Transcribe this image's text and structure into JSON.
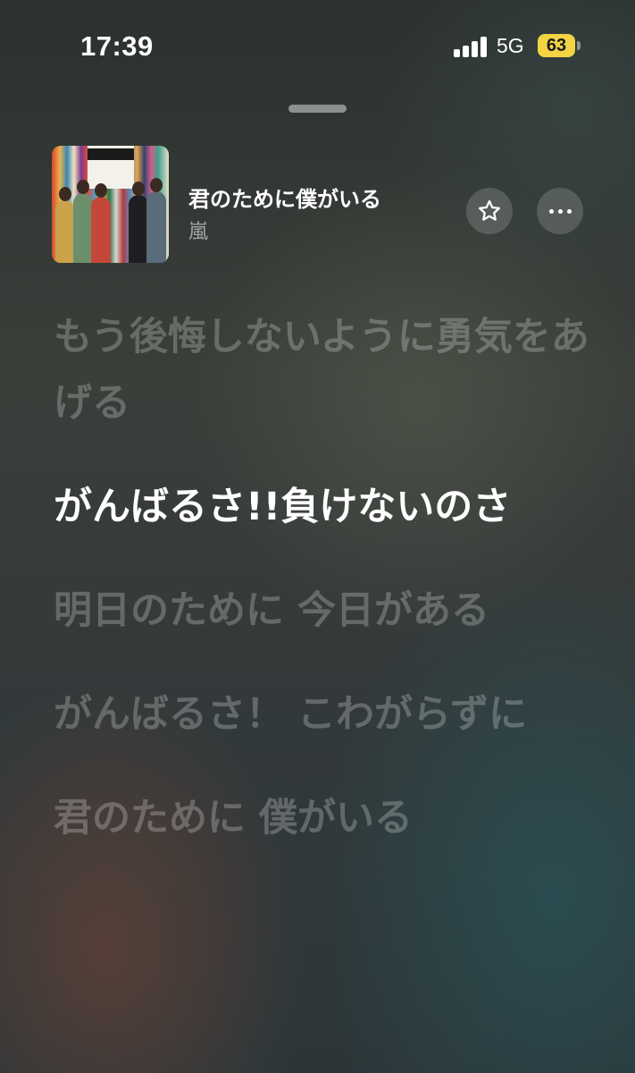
{
  "status_bar": {
    "time": "17:39",
    "network": "5G",
    "battery": "63",
    "battery_color": "#f2d445"
  },
  "now_playing": {
    "title": "君のために僕がいる",
    "artist": "嵐",
    "artwork_label": "ARASHI",
    "actions": [
      {
        "name": "favorite",
        "icon": "star-outline-icon"
      },
      {
        "name": "more",
        "icon": "ellipsis-icon"
      }
    ]
  },
  "lyrics": {
    "lines": [
      {
        "text": "もう後悔しないように勇気をあげる",
        "state": "past"
      },
      {
        "text": "がんばるさ!!負けないのさ",
        "state": "current"
      },
      {
        "text": "明日のために 今日がある",
        "state": "upcoming"
      },
      {
        "text": "がんばるさ！ こわがらずに",
        "state": "upcoming"
      },
      {
        "text": "君のために 僕がいる",
        "state": "upcoming"
      }
    ]
  }
}
